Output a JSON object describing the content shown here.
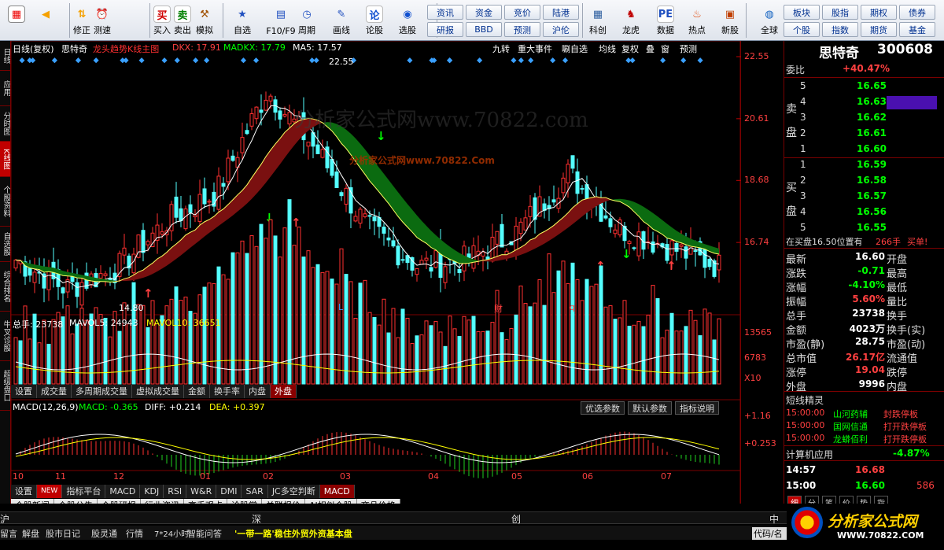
{
  "toolbar": {
    "buttons": [
      {
        "label": "",
        "icon": "back-arrow-icon"
      },
      {
        "label": "修正",
        "icon": "up-down-arrows-icon"
      },
      {
        "label": "测速",
        "icon": "alarm-clock-icon"
      },
      {
        "label": "买入",
        "icon": "buy-icon",
        "glyph": "买"
      },
      {
        "label": "卖出",
        "icon": "sell-icon",
        "glyph": "卖"
      },
      {
        "label": "模拟",
        "icon": "hammer-icon"
      },
      {
        "label": "自选",
        "icon": "star-folder-icon"
      },
      {
        "label": "F10/F9",
        "icon": "document-icon"
      },
      {
        "label": "周期",
        "icon": "clock-icon"
      },
      {
        "label": "画线",
        "icon": "pencil-icon"
      },
      {
        "label": "论股",
        "icon": "discuss-icon",
        "glyph": "论"
      },
      {
        "label": "选股",
        "icon": "chart-search-icon"
      },
      {
        "label": "科创",
        "icon": "mini-chart-icon"
      },
      {
        "label": "龙虎",
        "icon": "dragon-tiger-icon"
      },
      {
        "label": "数据",
        "icon": "pe-icon",
        "glyph": "PE"
      },
      {
        "label": "热点",
        "icon": "fire-icon"
      },
      {
        "label": "新股",
        "icon": "calendar-icon"
      },
      {
        "label": "全球",
        "icon": "globe-icon"
      }
    ],
    "market": [
      "资讯",
      "资金",
      "竞价",
      "陆港",
      "研报",
      "BBD",
      "预测",
      "沪伦"
    ],
    "right_market": [
      "板块",
      "股指",
      "期权",
      "债券",
      "个股",
      "指数",
      "期货",
      "基金"
    ]
  },
  "leftnav": [
    "日线",
    "应用",
    "分时图",
    "K线图",
    "个股资料",
    "自选股",
    "综合排名",
    "牛叉诊股",
    "超级盘口"
  ],
  "chart": {
    "info": {
      "period": "日线(复权)",
      "name": "思特奇",
      "formula": "龙头趋势K线主图",
      "dkx": "DKX: 17.91",
      "madkx": "MADKX: 17.79",
      "ma5": "MA5: 17.57"
    },
    "top_tabs": [
      "九转",
      "重大事件",
      "唰自选",
      "均线",
      "复权",
      "叠",
      "窗",
      "预测"
    ],
    "price_ticks": [
      "22.55",
      "20.61",
      "18.68",
      "16.74"
    ],
    "hi_label": "22.55",
    "lo_label": "14.80",
    "markers": [
      "L",
      "财",
      "q"
    ],
    "watermark": "分析家公式网www.70822.com",
    "watermark2": "分析家公式网www.70822.Com",
    "vol": {
      "label": "总手: 23738",
      "mavol5": "MAVOL5: 24943",
      "mavol10": "MAVOL10: 36651",
      "ticks": [
        "13565",
        "6783",
        "X10"
      ]
    },
    "vol_tabs": [
      "设置",
      "成交量",
      "多周期成交量",
      "虚拟成交量",
      "金额",
      "换手率",
      "内盘",
      "外盘"
    ],
    "macd": {
      "label": "MACD(12,26,9)",
      "macd": "MACD: -0.365",
      "diff": "DIFF: +0.214",
      "dea": "DEA: +0.397",
      "ticks": [
        "+1.16",
        "+0.253"
      ]
    },
    "macd_buttons": [
      "优选参数",
      "默认参数",
      "指标说明"
    ],
    "months": [
      "10",
      "11",
      "12",
      "01",
      "02",
      "03",
      "04",
      "05",
      "06",
      "07"
    ],
    "bottom_tabs": [
      "设置",
      "NEW",
      "指标平台",
      "MACD",
      "KDJ",
      "RSI",
      "W&R",
      "DMI",
      "SAR",
      "JC多空判断",
      "MACD"
    ],
    "news_tabs": [
      "个股新闻",
      "个股公告",
      "个股研报",
      "行业资讯",
      "高手观点",
      "论股堂",
      "关联报价",
      "AI相似个股",
      "商品价格"
    ]
  },
  "chart_data": {
    "type": "candlestick",
    "title": "思特奇 300608 日线(复权)",
    "x": [
      "10",
      "11",
      "12",
      "01",
      "02",
      "03",
      "04",
      "05",
      "06",
      "07"
    ],
    "ylim": [
      14.8,
      22.55
    ],
    "series": [
      {
        "name": "收盘",
        "values": [
          16.2,
          15.3,
          15.9,
          17.4,
          18.3,
          21.5,
          19.6,
          17.2,
          16.0,
          16.2,
          17.1,
          18.9,
          17.2,
          16.6,
          16.0
        ]
      },
      {
        "name": "MA5",
        "values": [
          16.4,
          15.6,
          15.4,
          16.8,
          17.9,
          20.2,
          19.8,
          17.7,
          16.4,
          16.0,
          16.7,
          17.9,
          17.57
        ]
      },
      {
        "name": "DKX",
        "values": [
          17.2,
          16.3,
          15.4,
          16.8,
          17.91
        ]
      },
      {
        "name": "MADKX",
        "values": [
          17.6,
          16.9,
          15.6,
          16.6,
          17.79
        ]
      }
    ],
    "volume": {
      "ticks": [
        "13565",
        "6783"
      ],
      "unit": "X10"
    },
    "macd": {
      "ticks": [
        "+1.16",
        "+0.253"
      ]
    }
  },
  "quote": {
    "name": "思特奇",
    "code": "300608",
    "weibi_label": "委比",
    "weibi": "+40.47%",
    "sell_label": [
      "卖",
      "盘"
    ],
    "buy_label": [
      "买",
      "盘"
    ],
    "sell": [
      [
        "5",
        "16.65"
      ],
      [
        "4",
        "16.63"
      ],
      [
        "3",
        "16.62"
      ],
      [
        "2",
        "16.61"
      ],
      [
        "1",
        "16.60"
      ]
    ],
    "buy": [
      [
        "1",
        "16.59"
      ],
      [
        "2",
        "16.58"
      ],
      [
        "3",
        "16.57"
      ],
      [
        "4",
        "16.56"
      ],
      [
        "5",
        "16.55"
      ]
    ],
    "orderline": "在买盘16.50位置有",
    "order_qty": "266手",
    "order_act": "买单!",
    "fields": [
      [
        "最新",
        "16.60",
        "开盘"
      ],
      [
        "涨跌",
        "-0.71",
        "最高"
      ],
      [
        "涨幅",
        "-4.10%",
        "最低"
      ],
      [
        "振幅",
        "5.60%",
        "量比"
      ],
      [
        "总手",
        "23738",
        "换手"
      ],
      [
        "金额",
        "4023万",
        "换手(实)"
      ],
      [
        "市盈(静)",
        "28.75",
        "市盈(动)"
      ],
      [
        "总市值",
        "26.17亿",
        "流通值"
      ],
      [
        "涨停",
        "19.04",
        "跌停"
      ],
      [
        "外盘",
        "9996",
        "内盘"
      ]
    ],
    "sprite_title": "短线精灵",
    "sprite": [
      [
        "15:00:00",
        "山河药辅",
        "封跌停板"
      ],
      [
        "15:00:00",
        "国网信通",
        "打开跌停板"
      ],
      [
        "15:00:00",
        "龙蟒佰利",
        "打开跌停板"
      ]
    ],
    "sector": "计算机应用",
    "sector_pct": "-4.87%",
    "ticks": [
      [
        "14:57",
        "16.68"
      ],
      [
        "15:00",
        "16.60",
        "586"
      ]
    ],
    "tabs": [
      "细",
      "分",
      "笔",
      "价",
      "势",
      "指"
    ]
  },
  "statusbar": {
    "row1": [
      "沪",
      "深",
      "创",
      "中"
    ],
    "row2": [
      "留言",
      "解盘",
      "股市日记",
      "股灵通",
      "行情",
      "7*24小时",
      "智能问答"
    ],
    "news": "'一带一路'稳住外贸外资基本盘",
    "code_label": "代码/名",
    "logo": "分析家公式网",
    "logo_url": "WWW.70822.COM"
  },
  "colors": {
    "up": "#ff3030",
    "down": "#54ffff",
    "ma5": "#ffffff",
    "vol_ma5": "#ffffff",
    "vol_ma10": "#ffff00",
    "band_up": "#7a1010",
    "band_dn": "#0b6b10",
    "yellow": "#ffff00"
  }
}
